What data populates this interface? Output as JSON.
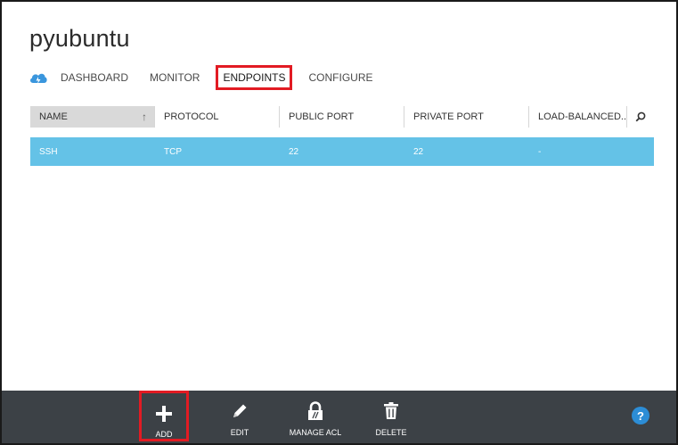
{
  "page": {
    "title": "pyubuntu"
  },
  "nav": {
    "icon": "cloud-service-icon",
    "tabs": [
      {
        "label": "DASHBOARD",
        "active": false
      },
      {
        "label": "MONITOR",
        "active": false
      },
      {
        "label": "ENDPOINTS",
        "active": true
      },
      {
        "label": "CONFIGURE",
        "active": false
      }
    ]
  },
  "table": {
    "columns": [
      "NAME",
      "PROTOCOL",
      "PUBLIC PORT",
      "PRIVATE PORT",
      "LOAD-BALANCED..."
    ],
    "sort_icon": "sort-ascending-icon",
    "search_icon": "search-icon",
    "rows": [
      {
        "name": "SSH",
        "protocol": "TCP",
        "public_port": "22",
        "private_port": "22",
        "load_balanced": "-"
      }
    ]
  },
  "commands": [
    {
      "label": "ADD",
      "icon": "plus-icon"
    },
    {
      "label": "EDIT",
      "icon": "pencil-icon"
    },
    {
      "label": "MANAGE ACL",
      "icon": "lock-icon"
    },
    {
      "label": "DELETE",
      "icon": "trash-icon"
    }
  ],
  "help": {
    "label": "?",
    "icon": "help-icon"
  },
  "colors": {
    "selected_row": "#64c2e7",
    "bottom_bar": "#3c4146",
    "highlight": "#e21b23",
    "help": "#2c8dd6"
  }
}
